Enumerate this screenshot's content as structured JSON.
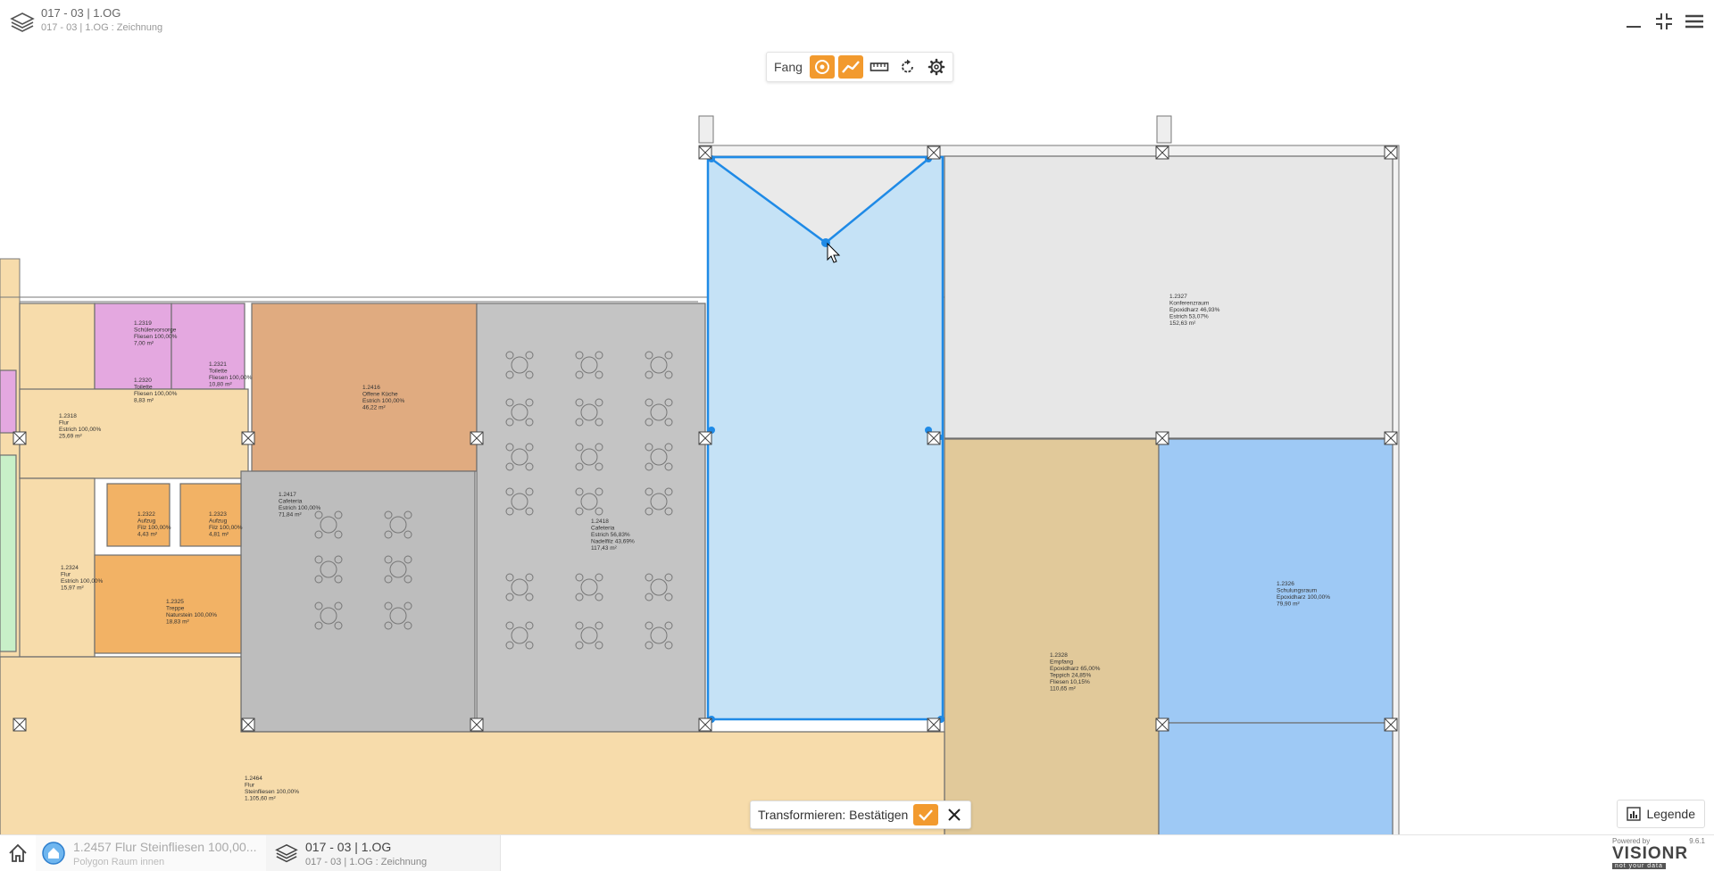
{
  "header": {
    "title": "017 - 03 | 1.OG",
    "subtitle": "017 - 03 | 1.OG : Zeichnung"
  },
  "toolbar": {
    "label": "Fang",
    "tools": [
      {
        "name": "snap-point",
        "icon": "target-icon",
        "active": true
      },
      {
        "name": "snap-line",
        "icon": "trend-line-icon",
        "active": true
      },
      {
        "name": "measure",
        "icon": "ruler-icon",
        "active": false
      },
      {
        "name": "rotate",
        "icon": "rotate-icon",
        "active": false
      },
      {
        "name": "settings",
        "icon": "gear-icon",
        "active": false
      }
    ]
  },
  "confirm_bar": {
    "text": "Transformieren: Bestätigen"
  },
  "legend": {
    "label": "Legende"
  },
  "bottom": {
    "tab1": {
      "title": "1.2457 Flur Steinfliesen 100,00...",
      "subtitle": "Polygon Raum innen"
    },
    "tab2": {
      "title": "017 - 03 | 1.OG",
      "subtitle": "017 - 03 | 1.OG : Zeichnung"
    },
    "powered_by": "Powered by",
    "version": "9.6.1",
    "brand": "VISIONR",
    "brand_tag": "not your data"
  },
  "rooms": [
    {
      "id": "room-2319",
      "lines": [
        "1.2319",
        "Schülervorsorge",
        "Fliesen 100,00%",
        "7,00 m²"
      ]
    },
    {
      "id": "room-2321",
      "lines": [
        "1.2321",
        "Toilette",
        "Fliesen 100,00%",
        "10,80 m²"
      ]
    },
    {
      "id": "room-2320",
      "lines": [
        "1.2320",
        "Toilette",
        "Fliesen 100,00%",
        "8,83 m²"
      ]
    },
    {
      "id": "room-2318",
      "lines": [
        "1.2318",
        "Flur",
        "Estrich 100,00%",
        "25,69 m²"
      ]
    },
    {
      "id": "room-2416",
      "lines": [
        "1.2416",
        "Offene Küche",
        "Estrich 100,00%",
        "46,22 m²"
      ]
    },
    {
      "id": "room-2327",
      "lines": [
        "1.2327",
        "Konferenzraum",
        "Epoxidharz 46,93%",
        "Estrich 53,07%",
        "152,63 m²"
      ]
    },
    {
      "id": "room-2417",
      "lines": [
        "1.2417",
        "Cafeteria",
        "Estrich 100,00%",
        "71,84 m²"
      ]
    },
    {
      "id": "room-2418",
      "lines": [
        "1.2418",
        "Cafeteria",
        "Estrich 56,83%",
        "Nadelfilz 43,69%",
        "117,43 m²"
      ]
    },
    {
      "id": "room-2322",
      "lines": [
        "1.2322",
        "Aufzug",
        "Filz 100,00%",
        "4,43 m²"
      ]
    },
    {
      "id": "room-2323",
      "lines": [
        "1.2323",
        "Aufzug",
        "Filz 100,00%",
        "4,81 m²"
      ]
    },
    {
      "id": "room-2324",
      "lines": [
        "1.2324",
        "Flur",
        "Estrich 100,00%",
        "15,97 m²"
      ]
    },
    {
      "id": "room-2325",
      "lines": [
        "1.2325",
        "Treppe",
        "Naturstein 100,00%",
        "18,83 m²"
      ]
    },
    {
      "id": "room-2326",
      "lines": [
        "1.2326",
        "Schulungsraum",
        "Epoxidharz 100,00%",
        "79,90 m²"
      ]
    },
    {
      "id": "room-2328",
      "lines": [
        "1.2328",
        "Empfang",
        "Epoxidharz 65,00%",
        "Teppich 24,85%",
        "Fliesen 10,15%",
        "110,65 m²"
      ]
    },
    {
      "id": "room-2464",
      "lines": [
        "1.2464",
        "Flur",
        "Steinfliesen 100,00%",
        "1.105,60 m²"
      ]
    }
  ]
}
